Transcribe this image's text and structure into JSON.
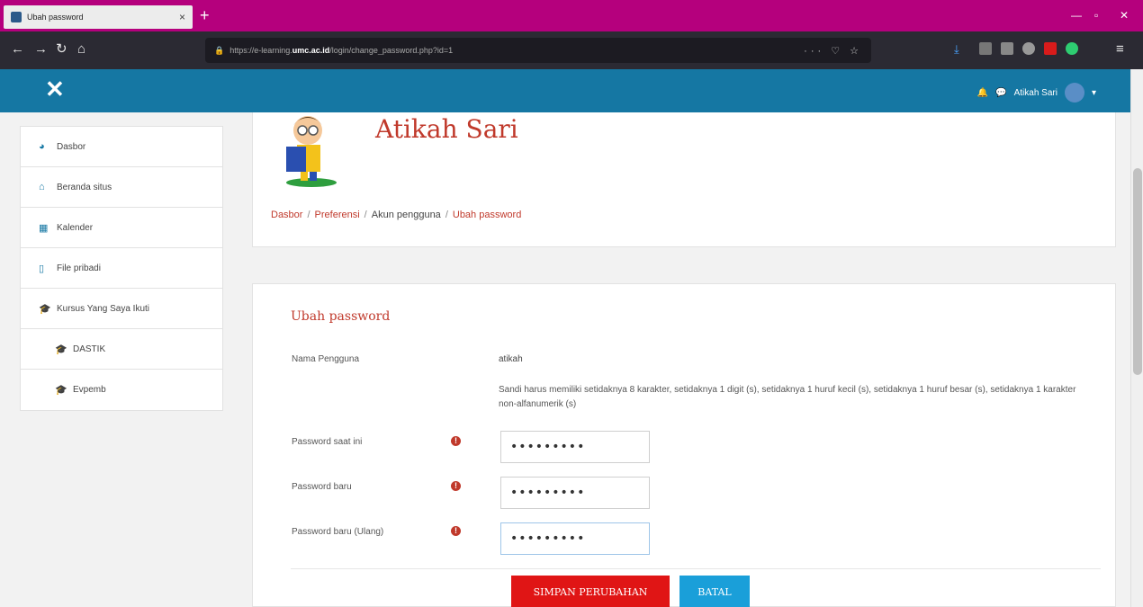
{
  "browser": {
    "tab_title": "Ubah password",
    "tab_close": "×",
    "new_tab": "+",
    "url_prefix": "https://e-learning.",
    "url_domain": "umc.ac.id",
    "url_suffix": "/login/change_password.php?id=1",
    "url_actions": "··· ♡ ☆"
  },
  "moodle": {
    "close": "✕",
    "user_name": "Atikah Sari",
    "user_caret": "▾"
  },
  "sidebar": {
    "items": [
      {
        "label": "Dasbor",
        "icon": "dashboard-icon",
        "glyph": "◕"
      },
      {
        "label": "Beranda situs",
        "icon": "home-icon",
        "glyph": "⌂"
      },
      {
        "label": "Kalender",
        "icon": "calendar-icon",
        "glyph": "▦"
      },
      {
        "label": "File pribadi",
        "icon": "file-icon",
        "glyph": "▯"
      },
      {
        "label": "Kursus Yang Saya Ikuti",
        "icon": "graduation-cap-icon",
        "glyph": "🎓"
      },
      {
        "label": "DASTIK",
        "icon": "graduation-cap-icon",
        "glyph": "🎓"
      },
      {
        "label": "Evpemb",
        "icon": "graduation-cap-icon",
        "glyph": "🎓"
      }
    ]
  },
  "header": {
    "title": "Atikah Sari",
    "breadcrumb": [
      "Dasbor",
      "Preferensi",
      "Akun pengguna",
      "Ubah password"
    ]
  },
  "form": {
    "title": "Ubah password",
    "username_label": "Nama Pengguna",
    "username_value": "atikah",
    "rule_text": "Sandi harus memiliki setidaknya 8 karakter, setidaknya 1 digit (s), setidaknya 1 huruf kecil (s), setidaknya 1 huruf besar (s), setidaknya 1 karakter non-alfanumerik (s)",
    "current_label": "Password saat ini",
    "new_label": "Password baru",
    "repeat_label": "Password baru (Ulang)",
    "current_value": "•••••••••",
    "new_value": "•••••••••",
    "repeat_value": "•••••••••",
    "required_glyph": "!",
    "save_label": "SIMPAN PERUBAHAN",
    "cancel_label": "BATAL"
  },
  "colors": {
    "accent_blue": "#1577a3",
    "brand_red": "#c0392b",
    "browser_tab": "#b5007d"
  }
}
